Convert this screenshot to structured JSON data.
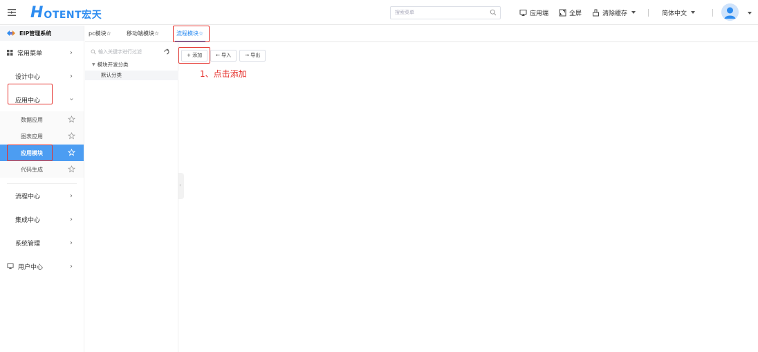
{
  "header": {
    "logo_mark": "H",
    "logo_text": "OTENT宏天",
    "search_placeholder": "搜索菜单",
    "app_end": "应用端",
    "fullscreen": "全屏",
    "clear_cache": "清除缓存",
    "language": "简体中文"
  },
  "sidebar": {
    "system_title": "EIP管理系统",
    "items": [
      {
        "label": "常用菜单"
      },
      {
        "label": "设计中心"
      },
      {
        "label": "应用中心"
      }
    ],
    "sub_items": [
      {
        "label": "数据应用"
      },
      {
        "label": "图表应用"
      },
      {
        "label": "应用模块"
      },
      {
        "label": "代码生成"
      }
    ],
    "items_after": [
      {
        "label": "流程中心"
      },
      {
        "label": "集成中心"
      },
      {
        "label": "系统管理"
      },
      {
        "label": "用户中心"
      }
    ]
  },
  "tabs": [
    {
      "label": "pc模块☆"
    },
    {
      "label": "移动端模块☆"
    },
    {
      "label": "流程模块☆"
    }
  ],
  "tree": {
    "filter_placeholder": "输入关键字进行过滤",
    "root": "模块开发分类",
    "child": "默认分类"
  },
  "toolbar": {
    "add": "+ 添加",
    "import": "← 导入",
    "export": "→ 导出"
  },
  "annotation": "1、点击添加",
  "colors": {
    "brand": "#2d8cf0",
    "active_menu": "#4c9df2",
    "highlight": "#e5322d"
  }
}
